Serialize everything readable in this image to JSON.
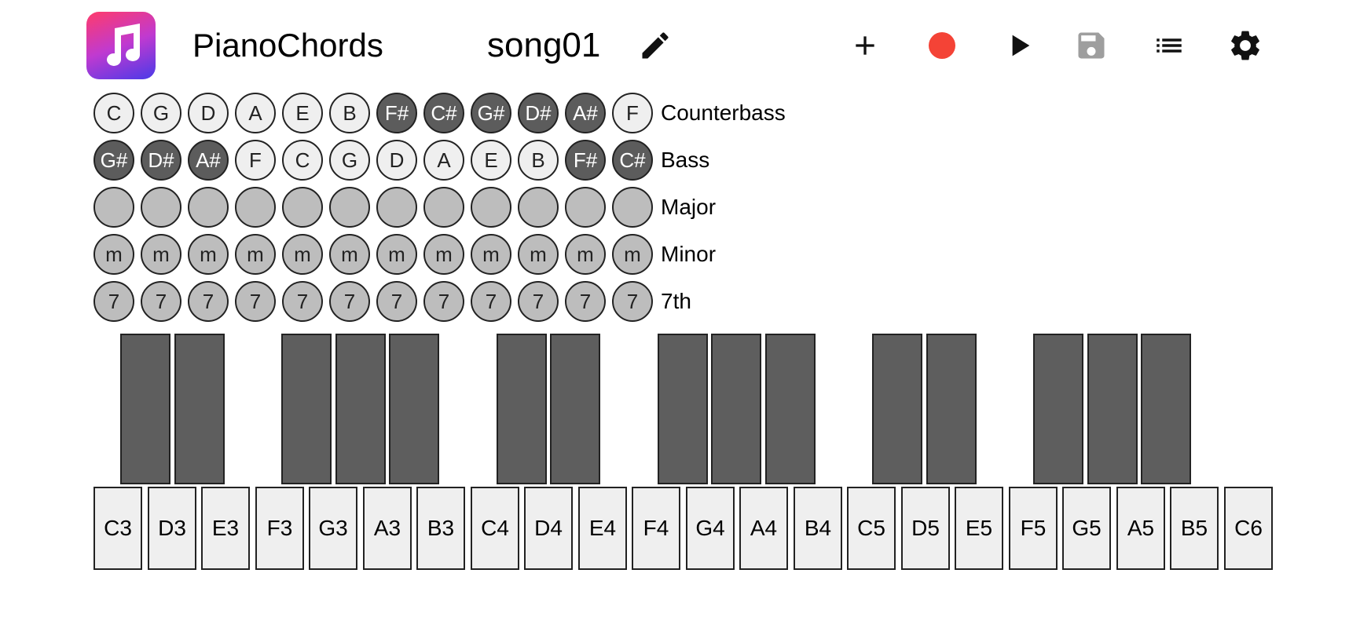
{
  "header": {
    "app_name": "PianoChords",
    "song_name": "song01",
    "icons": {
      "app": "music-note-icon",
      "edit": "pencil-icon",
      "add": "plus-icon",
      "record": "record-icon",
      "play": "play-icon",
      "save": "save-icon",
      "list": "list-icon",
      "settings": "gear-icon"
    },
    "colors": {
      "record": "#f44336",
      "save_disabled": "#9e9e9e"
    }
  },
  "bass_rows": [
    {
      "label": "Counterbass",
      "buttons": [
        {
          "text": "C",
          "style": "light"
        },
        {
          "text": "G",
          "style": "light"
        },
        {
          "text": "D",
          "style": "light"
        },
        {
          "text": "A",
          "style": "light"
        },
        {
          "text": "E",
          "style": "light"
        },
        {
          "text": "B",
          "style": "light"
        },
        {
          "text": "F#",
          "style": "dark"
        },
        {
          "text": "C#",
          "style": "dark"
        },
        {
          "text": "G#",
          "style": "dark"
        },
        {
          "text": "D#",
          "style": "dark"
        },
        {
          "text": "A#",
          "style": "dark"
        },
        {
          "text": "F",
          "style": "light"
        }
      ]
    },
    {
      "label": "Bass",
      "buttons": [
        {
          "text": "G#",
          "style": "dark"
        },
        {
          "text": "D#",
          "style": "dark"
        },
        {
          "text": "A#",
          "style": "dark"
        },
        {
          "text": "F",
          "style": "light"
        },
        {
          "text": "C",
          "style": "light"
        },
        {
          "text": "G",
          "style": "light"
        },
        {
          "text": "D",
          "style": "light"
        },
        {
          "text": "A",
          "style": "light"
        },
        {
          "text": "E",
          "style": "light"
        },
        {
          "text": "B",
          "style": "light"
        },
        {
          "text": "F#",
          "style": "dark"
        },
        {
          "text": "C#",
          "style": "dark"
        }
      ]
    },
    {
      "label": "Major",
      "buttons": [
        {
          "text": "",
          "style": "grey"
        },
        {
          "text": "",
          "style": "grey"
        },
        {
          "text": "",
          "style": "grey"
        },
        {
          "text": "",
          "style": "grey"
        },
        {
          "text": "",
          "style": "grey"
        },
        {
          "text": "",
          "style": "grey"
        },
        {
          "text": "",
          "style": "grey"
        },
        {
          "text": "",
          "style": "grey"
        },
        {
          "text": "",
          "style": "grey"
        },
        {
          "text": "",
          "style": "grey"
        },
        {
          "text": "",
          "style": "grey"
        },
        {
          "text": "",
          "style": "grey"
        }
      ]
    },
    {
      "label": "Minor",
      "buttons": [
        {
          "text": "m",
          "style": "grey"
        },
        {
          "text": "m",
          "style": "grey"
        },
        {
          "text": "m",
          "style": "grey"
        },
        {
          "text": "m",
          "style": "grey"
        },
        {
          "text": "m",
          "style": "grey"
        },
        {
          "text": "m",
          "style": "grey"
        },
        {
          "text": "m",
          "style": "grey"
        },
        {
          "text": "m",
          "style": "grey"
        },
        {
          "text": "m",
          "style": "grey"
        },
        {
          "text": "m",
          "style": "grey"
        },
        {
          "text": "m",
          "style": "grey"
        },
        {
          "text": "m",
          "style": "grey"
        }
      ]
    },
    {
      "label": "7th",
      "buttons": [
        {
          "text": "7",
          "style": "grey"
        },
        {
          "text": "7",
          "style": "grey"
        },
        {
          "text": "7",
          "style": "grey"
        },
        {
          "text": "7",
          "style": "grey"
        },
        {
          "text": "7",
          "style": "grey"
        },
        {
          "text": "7",
          "style": "grey"
        },
        {
          "text": "7",
          "style": "grey"
        },
        {
          "text": "7",
          "style": "grey"
        },
        {
          "text": "7",
          "style": "grey"
        },
        {
          "text": "7",
          "style": "grey"
        },
        {
          "text": "7",
          "style": "grey"
        },
        {
          "text": "7",
          "style": "grey"
        }
      ]
    }
  ],
  "keyboard": {
    "white_keys": [
      "C3",
      "D3",
      "E3",
      "F3",
      "G3",
      "A3",
      "B3",
      "C4",
      "D4",
      "E4",
      "F4",
      "G4",
      "A4",
      "B4",
      "C5",
      "D5",
      "E5",
      "F5",
      "G5",
      "A5",
      "B5",
      "C6"
    ]
  }
}
